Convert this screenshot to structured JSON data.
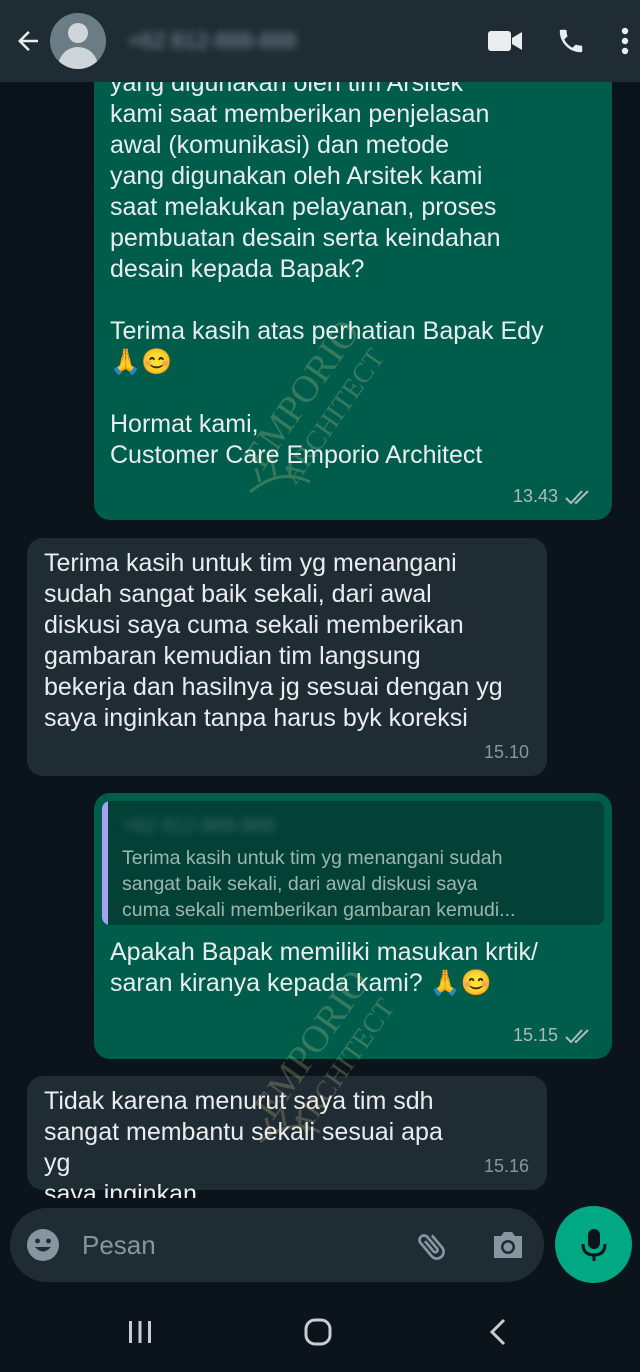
{
  "header": {
    "contact_name": "+62 812-888-888",
    "icons": [
      "back-arrow-icon",
      "video-call-icon",
      "phone-icon",
      "more-vert-icon"
    ]
  },
  "messages": [
    {
      "direction": "out",
      "text": "yang digunakan oleh tim Arsitek\nkami saat memberikan penjelasan\nawal (komunikasi) dan metode\nyang digunakan oleh Arsitek kami\nsaat melakukan pelayanan, proses\npembuatan desain serta keindahan\ndesain kepada Bapak?\n\nTerima kasih atas perhatian Bapak Edy\n🙏😊\n\nHormat kami,\nCustomer Care Emporio Architect",
      "time": "13.43",
      "status": "read"
    },
    {
      "direction": "in",
      "text": "Terima kasih untuk tim yg menangani\nsudah sangat baik sekali, dari awal\ndiskusi saya cuma sekali memberikan\ngambaran kemudian tim langsung\nbekerja dan hasilnya jg sesuai dengan yg\nsaya inginkan tanpa harus byk koreksi",
      "time": "15.10"
    },
    {
      "direction": "out",
      "quote": {
        "name": "+62 812-888-888",
        "text": "Terima kasih untuk tim yg menangani sudah\nsangat baik sekali, dari awal diskusi saya\ncuma sekali memberikan gambaran kemudi..."
      },
      "text": "Apakah Bapak memiliki masukan krtik/\nsaran kiranya kepada kami? 🙏😊",
      "time": "15.15",
      "status": "read"
    },
    {
      "direction": "in",
      "text": "Tidak karena menurut saya tim sdh\nsangat membantu sekali sesuai apa yg\nsaya inginkan",
      "time": "15.16"
    }
  ],
  "watermark": {
    "line1": "EMPORIO",
    "line2": "ARCHITECT"
  },
  "composer": {
    "placeholder": "Pesan",
    "icons": [
      "emoji-icon",
      "attach-icon",
      "camera-icon",
      "mic-icon"
    ]
  },
  "navbar": {
    "icons": [
      "recents-icon",
      "home-icon",
      "back-nav-icon"
    ]
  },
  "colors": {
    "background": "#0b141a",
    "header": "#1f2c34",
    "outgoing_bubble": "#005c4b",
    "incoming_bubble": "#202c33",
    "accent": "#00a884",
    "read_ticks": "#aebac1"
  }
}
